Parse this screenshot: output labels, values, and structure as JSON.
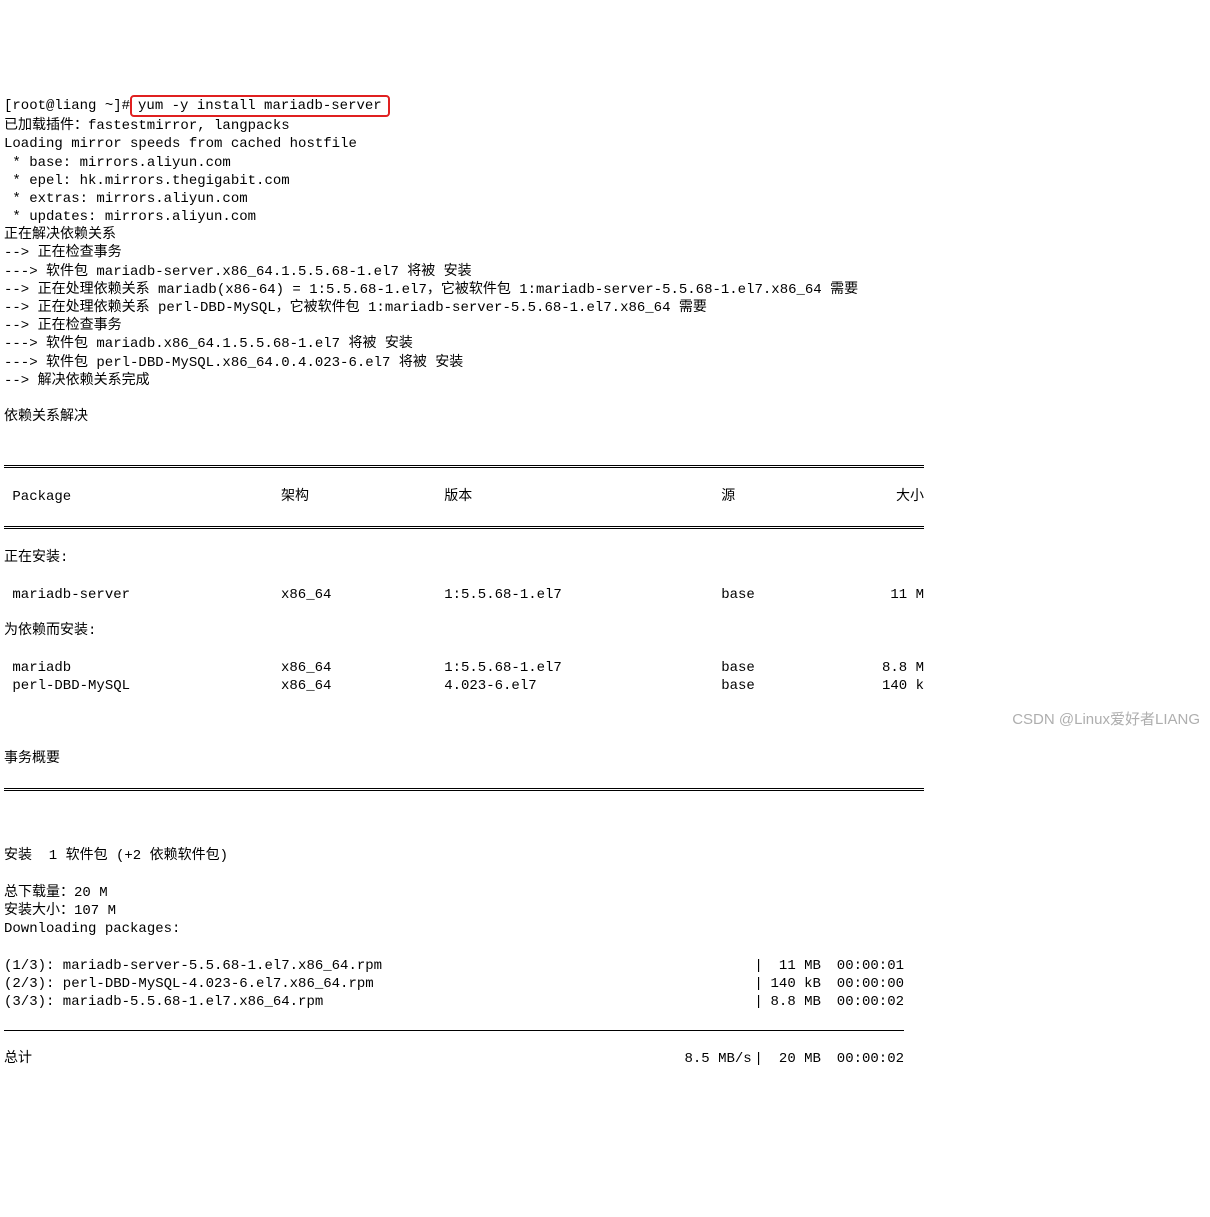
{
  "prompt": {
    "prefix": "[root@liang ~]#",
    "command": "yum -y install mariadb-server"
  },
  "header_lines": [
    "已加载插件：fastestmirror, langpacks",
    "Loading mirror speeds from cached hostfile",
    " * base: mirrors.aliyun.com",
    " * epel: hk.mirrors.thegigabit.com",
    " * extras: mirrors.aliyun.com",
    " * updates: mirrors.aliyun.com",
    "正在解决依赖关系",
    "--> 正在检查事务",
    "---> 软件包 mariadb-server.x86_64.1.5.5.68-1.el7 将被 安装",
    "--> 正在处理依赖关系 mariadb(x86-64) = 1:5.5.68-1.el7，它被软件包 1:mariadb-server-5.5.68-1.el7.x86_64 需要",
    "--> 正在处理依赖关系 perl-DBD-MySQL，它被软件包 1:mariadb-server-5.5.68-1.el7.x86_64 需要",
    "--> 正在检查事务",
    "---> 软件包 mariadb.x86_64.1.5.5.68-1.el7 将被 安装",
    "---> 软件包 perl-DBD-MySQL.x86_64.0.4.023-6.el7 将被 安装",
    "--> 解决依赖关系完成",
    "",
    "依赖关系解决",
    ""
  ],
  "table": {
    "headers": {
      "pkg": " Package",
      "arch": "架构",
      "ver": "版本",
      "repo": "源",
      "size": "大小"
    },
    "section_install": "正在安装:",
    "section_deps": "为依赖而安装:",
    "rows_install": [
      {
        "pkg": " mariadb-server",
        "arch": "x86_64",
        "ver": "1:5.5.68-1.el7",
        "repo": "base",
        "size": "11 M"
      }
    ],
    "rows_deps": [
      {
        "pkg": " mariadb",
        "arch": "x86_64",
        "ver": "1:5.5.68-1.el7",
        "repo": "base",
        "size": "8.8 M"
      },
      {
        "pkg": " perl-DBD-MySQL",
        "arch": "x86_64",
        "ver": "4.023-6.el7",
        "repo": "base",
        "size": "140 k"
      }
    ]
  },
  "summary_header": "事务概要",
  "summary_lines": [
    "安装  1 软件包 (+2 依赖软件包)",
    "",
    "总下载量：20 M",
    "安装大小：107 M",
    "Downloading packages:"
  ],
  "downloads": [
    {
      "name": "(1/3): mariadb-server-5.5.68-1.el7.x86_64.rpm",
      "size": " 11 MB",
      "time": "00:00:01"
    },
    {
      "name": "(2/3): perl-DBD-MySQL-4.023-6.el7.x86_64.rpm",
      "size": "140 kB",
      "time": "00:00:00"
    },
    {
      "name": "(3/3): mariadb-5.5.68-1.el7.x86_64.rpm",
      "size": "8.8 MB",
      "time": "00:00:02"
    }
  ],
  "total": {
    "label": "总计",
    "speed": "8.5 MB/s",
    "size": " 20 MB",
    "time": "00:00:02"
  },
  "watermark": "CSDN @Linux爱好者LIANG"
}
